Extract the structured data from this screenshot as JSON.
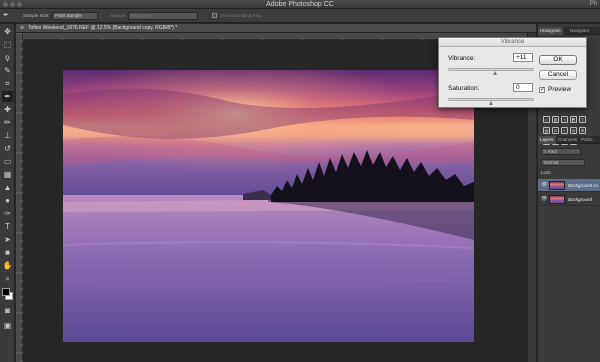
{
  "window": {
    "title": "Adobe Photoshop CC",
    "title_right": "Ph"
  },
  "options_bar": {
    "sample_size_label": "Sample Size:",
    "sample_size_value": "Point Sample",
    "sample_label": "Sample:",
    "sample_value": "All Layers",
    "show_ring_label": "Show Sampling Ring"
  },
  "document": {
    "tab_title": "Tofino Weekend_1676.NEF @ 12.5% (Background copy, RGB/8*) *"
  },
  "dialog": {
    "title": "Vibrance",
    "vibrance_label": "Vibrance:",
    "vibrance_value": "+11",
    "vibrance_level": 0.555,
    "saturation_label": "Saturation:",
    "saturation_value": "0",
    "saturation_level": 0.5,
    "ok_label": "OK",
    "cancel_label": "Cancel",
    "preview_label": "Preview",
    "preview_checked": true
  },
  "panels": {
    "top_tabs": [
      "Histogram",
      "Navigator"
    ],
    "layers_tabs": [
      "Layers",
      "Channels",
      "Paths"
    ],
    "kind_label": "Kind",
    "blend_mode": "Normal",
    "lock_label": "Lock:",
    "layers": [
      {
        "name": "Background co",
        "selected": true
      },
      {
        "name": "Background",
        "selected": false
      }
    ]
  },
  "colors": {
    "accent": "#5c6d86",
    "dialog_bg": "#e8e8e8",
    "workspace": "#262626"
  }
}
